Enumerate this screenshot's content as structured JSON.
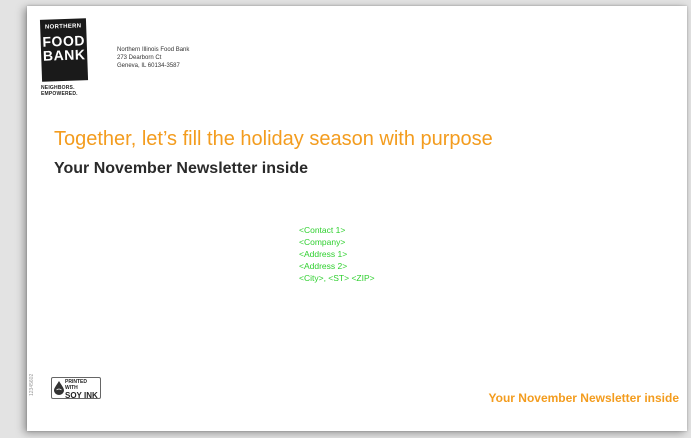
{
  "logo": {
    "line1": "NORTHERN",
    "line2": "FOOD",
    "line3": "BANK",
    "tagline1": "NEIGHBORS.",
    "tagline2": "EMPOWERED."
  },
  "return_address": {
    "name": "Northern Illinois Food Bank",
    "street": "273 Dearborn Ct",
    "city": "Geneva, IL 60134-3587"
  },
  "headline": "Together, let’s fill the holiday season with purpose",
  "subhead": "Your November Newsletter inside",
  "mailing_fields": [
    "<Contact 1>",
    "<Company>",
    "<Address 1>",
    "<Address 2>",
    "<City>, <ST> <ZIP>"
  ],
  "soy_ink": {
    "line1": "PRINTED WITH",
    "line2": "SOY INK"
  },
  "side_code": "12345602",
  "footer_text": "Your November Newsletter inside",
  "colors": {
    "accent_orange": "#f39c1e",
    "mailing_green": "#2fd02f",
    "logo_black": "#1a1a1a"
  }
}
